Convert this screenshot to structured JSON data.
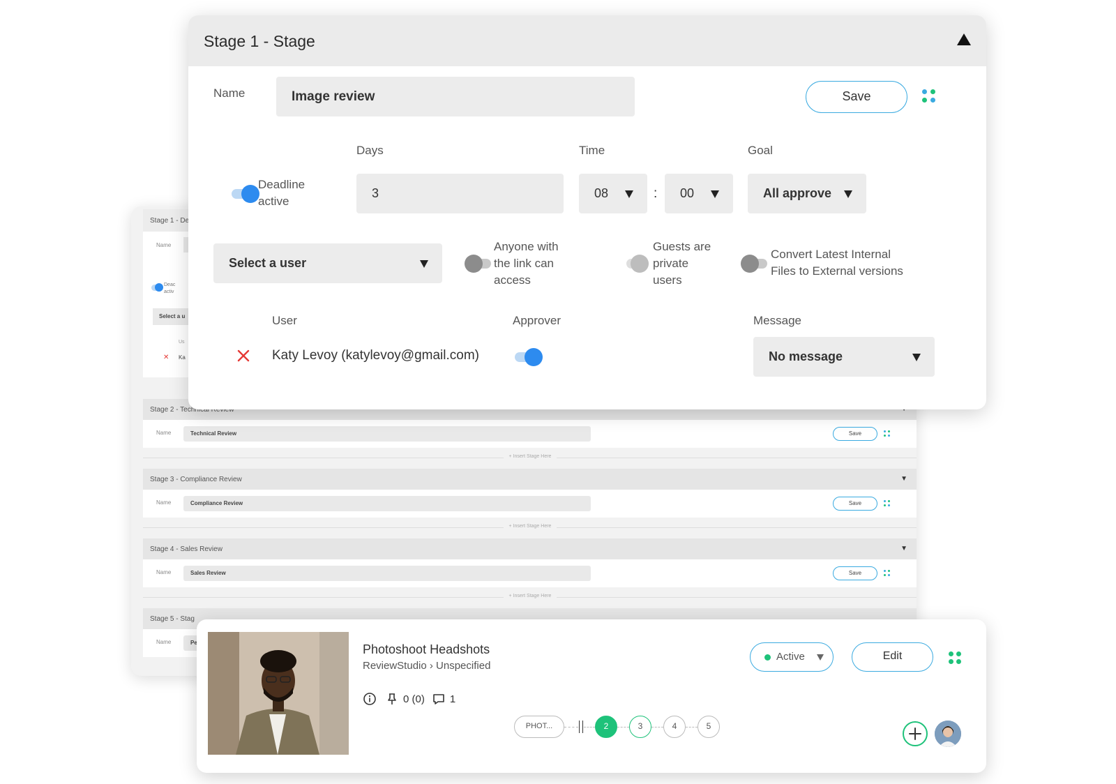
{
  "background_stack": {
    "stage1": {
      "title": "Stage 1 - De",
      "name_label": "Name",
      "deadline_label": "Deac activ",
      "select_user": "Select a u",
      "user_label": "Us",
      "user_value": "Ka"
    },
    "stages": [
      {
        "title": "Stage 2 - Technical Review",
        "name_label": "Name",
        "name_value": "Technical Review",
        "save_label": "Save"
      },
      {
        "title": "Stage 3 - Compliance Review",
        "name_label": "Name",
        "name_value": "Compliance Review",
        "save_label": "Save"
      },
      {
        "title": "Stage 4 - Sales Review",
        "name_label": "Name",
        "name_value": "Sales Review",
        "save_label": "Save"
      }
    ],
    "insert_label": "+ Insert Stage Here",
    "stage5": {
      "title": "Stage 5 - Stag",
      "name_label": "Name",
      "name_value": "Pe"
    }
  },
  "main_stage": {
    "title": "Stage 1 - Stage",
    "name_label": "Name",
    "name_value": "Image review",
    "save_label": "Save",
    "days_label": "Days",
    "time_label": "Time",
    "goal_label": "Goal",
    "deadline_label_1": "Deadline",
    "deadline_label_2": "active",
    "days_value": "3",
    "hour_value": "08",
    "time_separator": ":",
    "minute_value": "00",
    "goal_value": "All approve",
    "select_user_label": "Select a user",
    "anyone_link_1": "Anyone with",
    "anyone_link_2": "the link can",
    "anyone_link_3": "access",
    "guests_1": "Guests are",
    "guests_2": "private",
    "guests_3": "users",
    "convert_1": "Convert Latest Internal",
    "convert_2": "Files to External versions",
    "user_col": "User",
    "approver_col": "Approver",
    "message_col": "Message",
    "user_entry": "Katy Levoy (katylevoy@gmail.com)",
    "message_value": "No message"
  },
  "project": {
    "title": "Photoshoot Headshots",
    "breadcrumb": "ReviewStudio › Unspecified",
    "pins": "0 (0)",
    "comments": "1",
    "status": "Active",
    "edit_label": "Edit",
    "stage_pill": "PHOT...",
    "steps": [
      "2",
      "3",
      "4",
      "5"
    ]
  },
  "colors": {
    "accent_blue": "#2d8bef",
    "outline_blue": "#3aaae0",
    "green": "#1ec27a",
    "danger_red": "#e53935"
  }
}
